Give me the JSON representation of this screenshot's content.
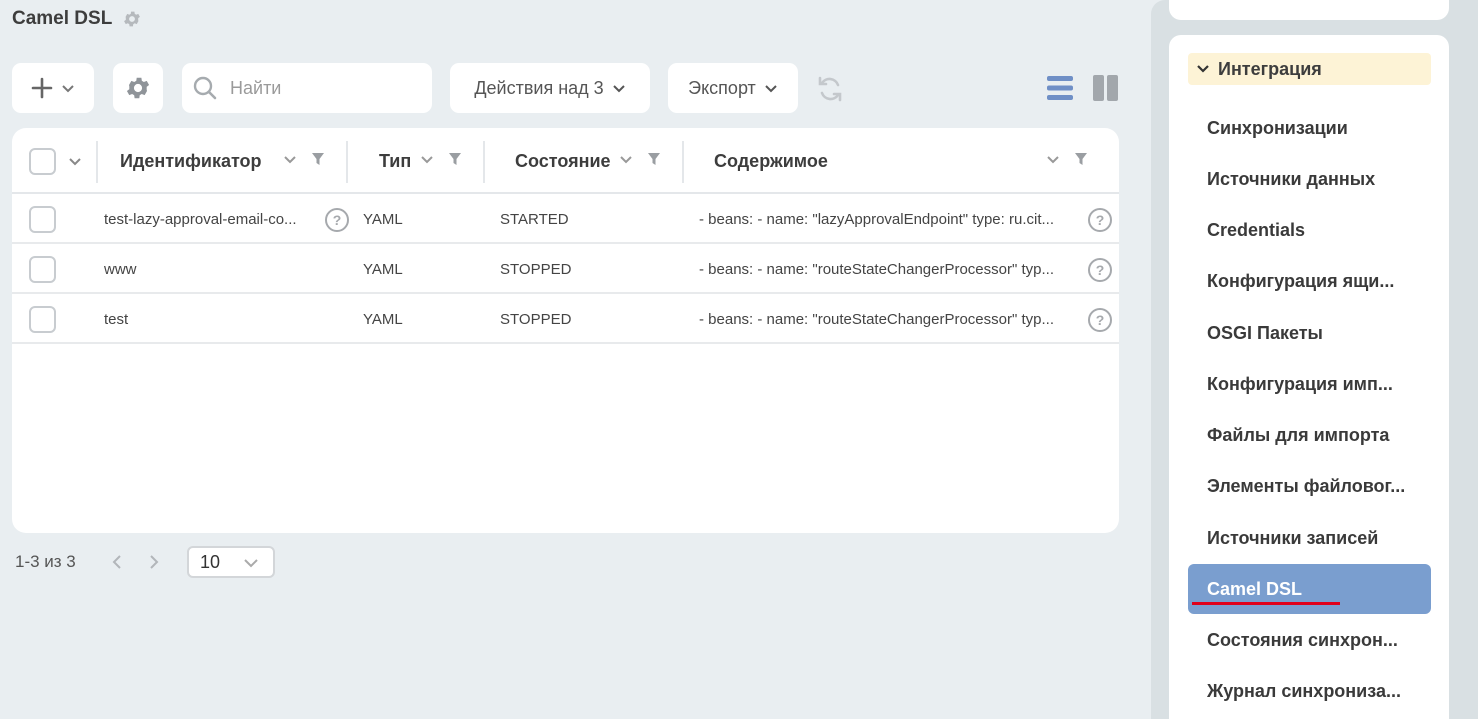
{
  "page": {
    "title": "Camel DSL"
  },
  "toolbar": {
    "search_placeholder": "Найти",
    "actions_label": "Действия над 3",
    "export_label": "Экспорт"
  },
  "grid": {
    "columns": [
      "Идентификатор",
      "Тип",
      "Состояние",
      "Содержимое"
    ],
    "rows": [
      {
        "id": "test-lazy-approval-email-co...",
        "type": "YAML",
        "state": "STARTED",
        "content": "- beans: - name: \"lazyApprovalEndpoint\" type: ru.cit..."
      },
      {
        "id": "www",
        "type": "YAML",
        "state": "STOPPED",
        "content": "- beans: - name: \"routeStateChangerProcessor\" typ..."
      },
      {
        "id": "test",
        "type": "YAML",
        "state": "STOPPED",
        "content": "- beans: - name: \"routeStateChangerProcessor\" typ..."
      }
    ]
  },
  "pager": {
    "summary": "1-3 из 3",
    "page_size": "10"
  },
  "sidebar": {
    "section": "Интеграция",
    "items": [
      "Синхронизации",
      "Источники данных",
      "Credentials",
      "Конфигурация ящи...",
      "OSGI Пакеты",
      "Конфигурация имп...",
      "Файлы для импорта",
      "Элементы файловог...",
      "Источники записей",
      "Camel DSL",
      "Состояния синхрон...",
      "Журнал синхрониза..."
    ],
    "active_index": 9
  },
  "colors": {
    "accent": "#7a9ecf",
    "section_bg": "#fdf3d6",
    "highlight": "#e0001b"
  }
}
